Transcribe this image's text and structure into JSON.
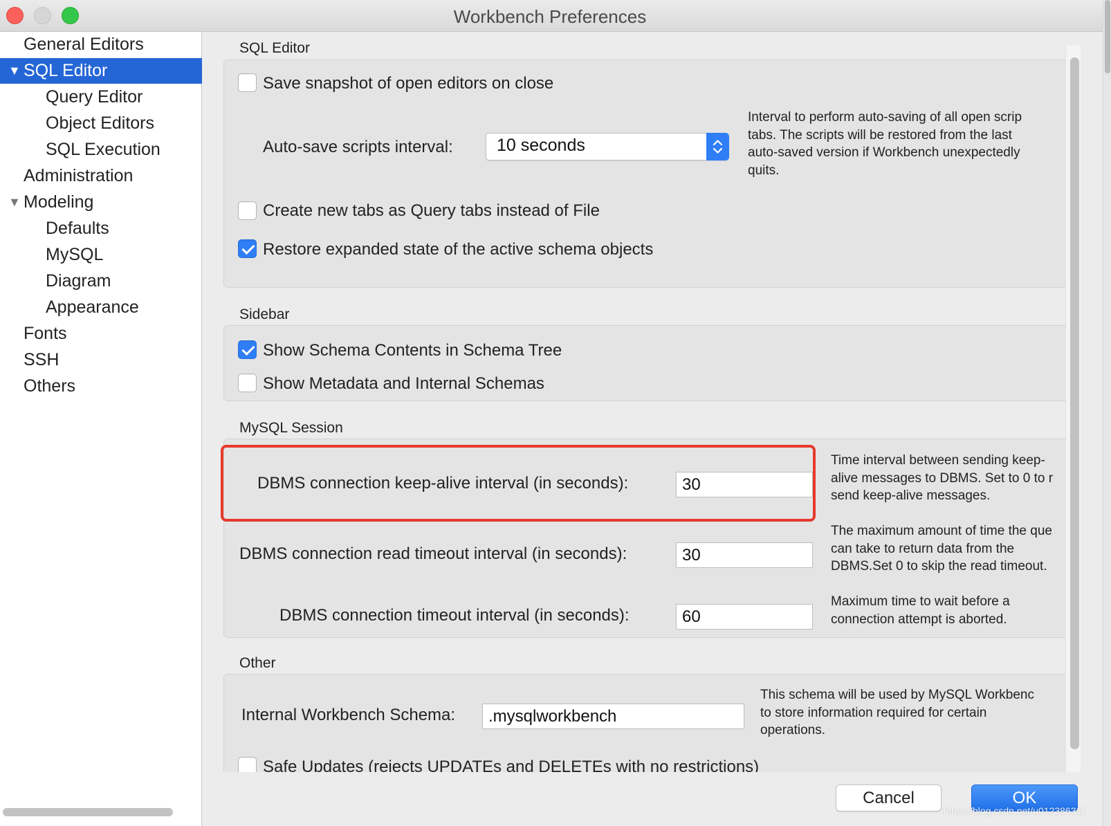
{
  "window": {
    "title": "Workbench Preferences"
  },
  "sidebar": {
    "items": [
      {
        "label": "General Editors"
      },
      {
        "label": "SQL Editor",
        "selected": true,
        "expanded": true
      },
      {
        "label": "Query Editor"
      },
      {
        "label": "Object Editors"
      },
      {
        "label": "SQL Execution"
      },
      {
        "label": "Administration"
      },
      {
        "label": "Modeling",
        "expanded": true
      },
      {
        "label": "Defaults"
      },
      {
        "label": "MySQL"
      },
      {
        "label": "Diagram"
      },
      {
        "label": "Appearance"
      },
      {
        "label": "Fonts"
      },
      {
        "label": "SSH"
      },
      {
        "label": "Others"
      }
    ]
  },
  "sql_editor": {
    "title": "SQL Editor",
    "save_snapshot": {
      "label": "Save snapshot of open editors on close",
      "checked": false
    },
    "autosave": {
      "label": "Auto-save scripts interval:",
      "value": "10 seconds",
      "help": [
        "Interval to perform auto-saving of all open scrip",
        "tabs. The scripts will be restored from the last",
        "auto-saved version if Workbench unexpectedly",
        "quits."
      ]
    },
    "new_tabs_query": {
      "label": "Create new tabs as Query tabs instead of File",
      "checked": false
    },
    "restore_expanded": {
      "label": "Restore expanded state of the active schema objects",
      "checked": true
    }
  },
  "sidebar_section": {
    "title": "Sidebar",
    "show_schema_contents": {
      "label": "Show Schema Contents in Schema Tree",
      "checked": true
    },
    "show_metadata": {
      "label": "Show Metadata and Internal Schemas",
      "checked": false
    }
  },
  "mysql_session": {
    "title": "MySQL Session",
    "keepalive": {
      "label": "DBMS connection keep-alive interval (in seconds):",
      "value": "30",
      "help": [
        "Time interval between sending keep-",
        "alive messages to DBMS. Set to 0 to r",
        "send keep-alive messages."
      ]
    },
    "read_timeout": {
      "label": "DBMS connection read timeout interval (in seconds):",
      "value": "30",
      "help": [
        "The maximum amount of time the que",
        "can take to return data from the",
        "DBMS.Set 0 to skip the read timeout."
      ]
    },
    "conn_timeout": {
      "label": "DBMS connection timeout interval (in seconds):",
      "value": "60",
      "help": [
        "Maximum time to wait before a",
        "connection attempt is aborted."
      ]
    }
  },
  "other": {
    "title": "Other",
    "internal_schema": {
      "label": "Internal Workbench Schema:",
      "value": ".mysqlworkbench",
      "help": [
        "This schema will be used by MySQL Workbenc",
        "to store information required for certain",
        "operations."
      ]
    },
    "safe_updates": {
      "label": "Safe Updates (rejects UPDATEs and DELETEs with no restrictions)",
      "checked": false
    }
  },
  "buttons": {
    "cancel": "Cancel",
    "ok": "OK"
  },
  "watermark": "https://blog.csdn.net/u012386311",
  "colors": {
    "accent": "#2f7ef6",
    "selection": "#2466d6",
    "highlight": "#e63a2e"
  }
}
